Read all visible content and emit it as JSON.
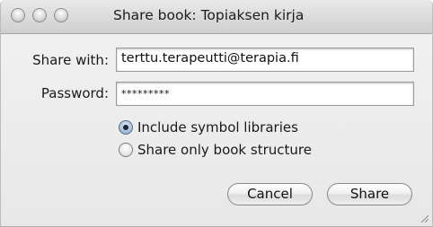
{
  "window": {
    "title": "Share book: Topiaksen kirja"
  },
  "form": {
    "share_with_label": "Share with:",
    "share_with_value": "terttu.terapeutti@terapia.fi",
    "password_label": "Password:",
    "password_value": "*********"
  },
  "options": [
    {
      "label": "Include symbol libraries",
      "selected": true
    },
    {
      "label": "Share only book structure",
      "selected": false
    }
  ],
  "buttons": {
    "cancel_label": "Cancel",
    "share_label": "Share"
  },
  "icons": {
    "close": "close-icon",
    "minimize": "minimize-icon",
    "zoom": "zoom-icon",
    "resize": "resize-grip-icon"
  }
}
